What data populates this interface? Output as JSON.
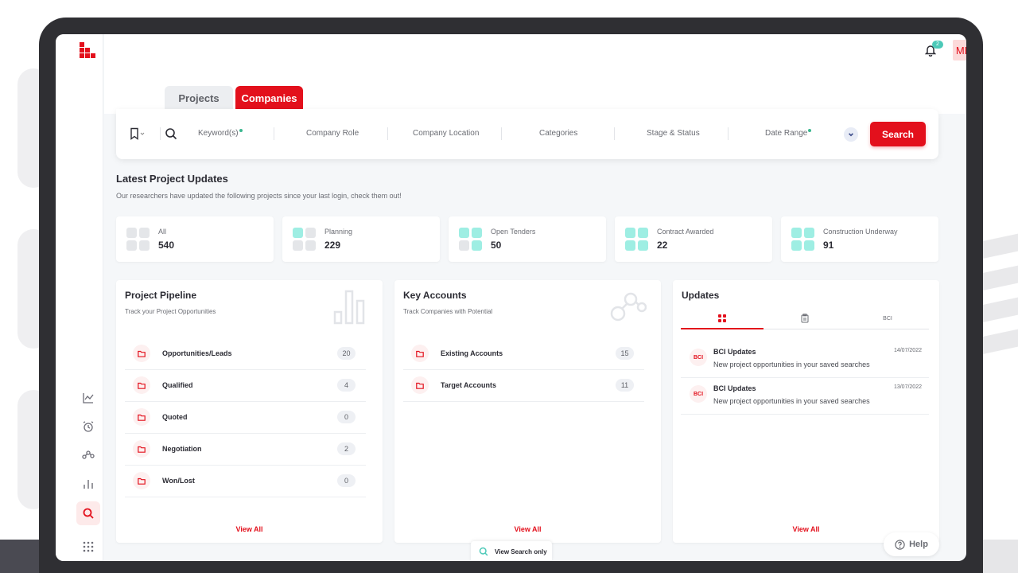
{
  "header": {
    "notification_count": "2",
    "avatar_initials": "MD"
  },
  "tabs": [
    {
      "label": "Projects"
    },
    {
      "label": "Companies"
    }
  ],
  "search": {
    "fields": [
      "Keyword(s)",
      "Company Role",
      "Company Location",
      "Categories",
      "Stage & Status",
      "Date Range"
    ],
    "button_label": "Search"
  },
  "updates_section": {
    "title": "Latest Project Updates",
    "subtitle": "Our researchers have updated the following projects since your last login, check them out!"
  },
  "stats": [
    {
      "label": "All",
      "value": "540"
    },
    {
      "label": "Planning",
      "value": "229"
    },
    {
      "label": "Open Tenders",
      "value": "50"
    },
    {
      "label": "Contract Awarded",
      "value": "22"
    },
    {
      "label": "Construction Underway",
      "value": "91"
    }
  ],
  "pipeline": {
    "title": "Project Pipeline",
    "subtitle": "Track your Project Opportunities",
    "rows": [
      {
        "label": "Opportunities/Leads",
        "count": "20"
      },
      {
        "label": "Qualified",
        "count": "4"
      },
      {
        "label": "Quoted",
        "count": "0"
      },
      {
        "label": "Negotiation",
        "count": "2"
      },
      {
        "label": "Won/Lost",
        "count": "0"
      }
    ],
    "view_all": "View All"
  },
  "key_accounts": {
    "title": "Key Accounts",
    "subtitle": "Track Companies with Potential",
    "rows": [
      {
        "label": "Existing Accounts",
        "count": "15"
      },
      {
        "label": "Target Accounts",
        "count": "11"
      }
    ],
    "view_all": "View All"
  },
  "updates": {
    "title": "Updates",
    "tab_bci_label": "BCI",
    "items": [
      {
        "logo": "BCI",
        "title": "BCI Updates",
        "desc": "New project opportunities in your saved searches",
        "date": "14/07/2022"
      },
      {
        "logo": "BCI",
        "title": "BCI Updates",
        "desc": "New project opportunities in your saved searches",
        "date": "13/07/2022"
      }
    ],
    "view_all": "View All"
  },
  "view_search_label": "View Search only",
  "help_label": "Help",
  "colors": {
    "brand_red": "#e3101c",
    "accent_teal": "#4cc9b8",
    "status_green": "#3bb78f"
  },
  "icons": [
    "bookmark-icon",
    "search-icon",
    "bell-icon",
    "chevron-down-icon",
    "folder-icon",
    "chart-line-icon",
    "alarm-icon",
    "network-icon",
    "bar-chart-icon",
    "grid-icon",
    "clipboard-icon",
    "help-icon"
  ]
}
